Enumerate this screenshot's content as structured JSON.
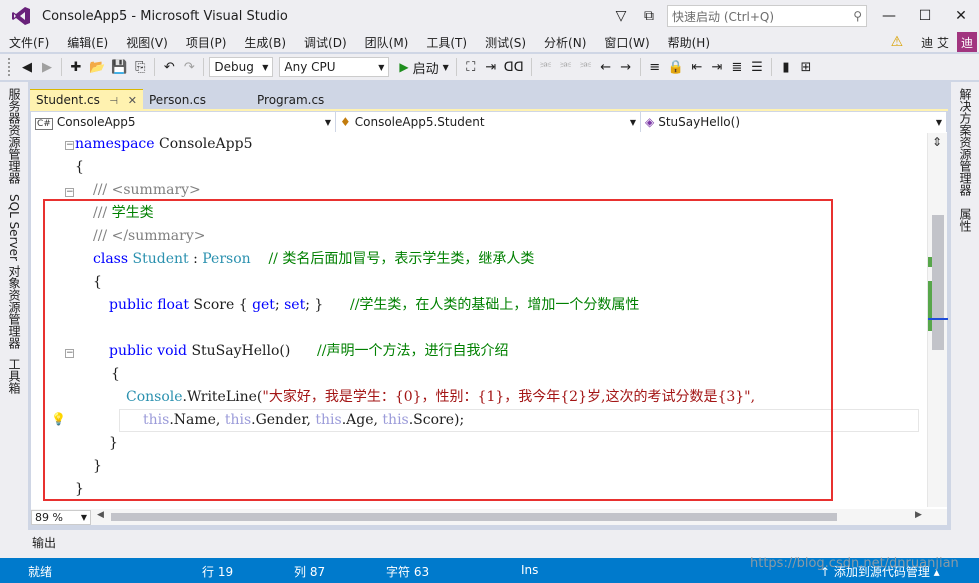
{
  "window": {
    "title": "ConsoleApp5 - Microsoft Visual Studio",
    "quick_launch_placeholder": "快速启动 (Ctrl+Q)"
  },
  "menu": [
    "文件(F)",
    "编辑(E)",
    "视图(V)",
    "项目(P)",
    "生成(B)",
    "调试(D)",
    "团队(M)",
    "工具(T)",
    "测试(S)",
    "分析(N)",
    "窗口(W)",
    "帮助(H)"
  ],
  "menu_right": {
    "user": "迪 艾",
    "avatar": "迪"
  },
  "toolbar": {
    "config": "Debug",
    "platform": "Any CPU",
    "start": "启动"
  },
  "left_rail": {
    "tabs": [
      "服务器资源管理器",
      "SQL Server 对象资源管理器",
      "工具箱"
    ]
  },
  "right_rail": {
    "tabs": [
      "解决方案资源管理器",
      "属性"
    ]
  },
  "doc_tabs": [
    {
      "label": "Student.cs",
      "active": true
    },
    {
      "label": "Person.cs",
      "active": false
    },
    {
      "label": "Program.cs",
      "active": false
    }
  ],
  "nav": {
    "project": "ConsoleApp5",
    "type": "ConsoleApp5.Student",
    "member": "StuSayHello()"
  },
  "code": {
    "l1": {
      "kw": "namespace",
      "rest": " ConsoleApp5"
    },
    "l2": "{",
    "l3": {
      "a": "/// ",
      "b": "<summary>"
    },
    "l4": {
      "a": "/// ",
      "b": "学生类"
    },
    "l5": {
      "a": "/// ",
      "b": "</summary>"
    },
    "l6": {
      "kw": "class",
      "t1": "Student",
      "sep": " : ",
      "t2": "Person",
      "comment": "// 类名后面加冒号，表示学生类，继承人类"
    },
    "l7": "{",
    "l8": {
      "kw1": "public",
      "kw2": "float",
      "name": "Score { ",
      "get": "get",
      "semi": "; ",
      "set": "set",
      "end": "; }",
      "comment": "//学生类，在人类的基础上，增加一个分数属性"
    },
    "l9": {
      "kw1": "public",
      "kw2": "void",
      "name": "StuSayHello()",
      "comment": "//声明一个方法，进行自我介绍"
    },
    "l10": "{",
    "l11": {
      "type": "Console",
      "method": ".WriteLine(",
      "str": "\"大家好，我是学生：{0}，性别：{1}，我今年{2}岁,这次的考试分数是{3}\","
    },
    "l12": {
      "t1": "this",
      "p1": ".Name, ",
      "t2": "this",
      "p2": ".Gender, ",
      "t3": "this",
      "p3": ".Age, ",
      "t4": "this",
      "p4": ".Score);"
    },
    "l13": "}",
    "l14": "}",
    "l15": "}"
  },
  "zoom": "89 %",
  "output_label": "输出",
  "status": {
    "ready": "就绪",
    "line": "行 19",
    "col": "列 87",
    "char": "字符 63",
    "ins": "Ins",
    "source_control": "↑ 添加到源代码管理 ▴"
  },
  "watermark": "https://blog.csdn.net/dnruanjian",
  "colors": {
    "accent": "#007acc",
    "highlight_box": "#e8312f",
    "active_tab": "#fff2b0"
  }
}
